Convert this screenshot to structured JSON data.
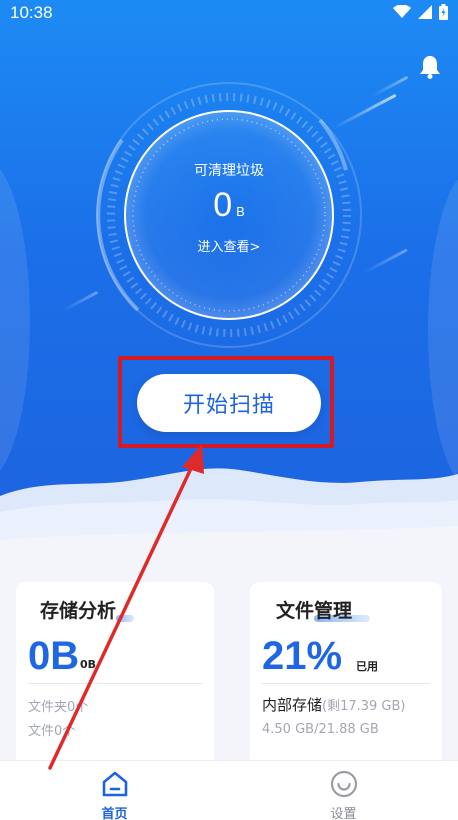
{
  "status_bar": {
    "time": "10:38"
  },
  "header": {
    "bell_icon": "bell-icon"
  },
  "gauge": {
    "label": "可清理垃圾",
    "value": "0",
    "unit": "B",
    "link": "进入查看>"
  },
  "scan_button": {
    "label": "开始扫描"
  },
  "storage_card": {
    "title": "存储分析",
    "value": "0B",
    "sub": "0B",
    "folders": "文件夹0个",
    "files": "文件0个"
  },
  "file_card": {
    "title": "文件管理",
    "percent": "21%",
    "used_label": "已用",
    "storage_label": "内部存储",
    "remaining": "(剩17.39 GB)",
    "usage": "4.50 GB/21.88 GB"
  },
  "bottom_nav": {
    "items": [
      {
        "label": "首页",
        "icon": "home-icon",
        "active": true
      },
      {
        "label": "设置",
        "icon": "smiley-icon",
        "active": false
      }
    ]
  },
  "colors": {
    "primary": "#1e63df",
    "highlight": "#d61a24"
  }
}
